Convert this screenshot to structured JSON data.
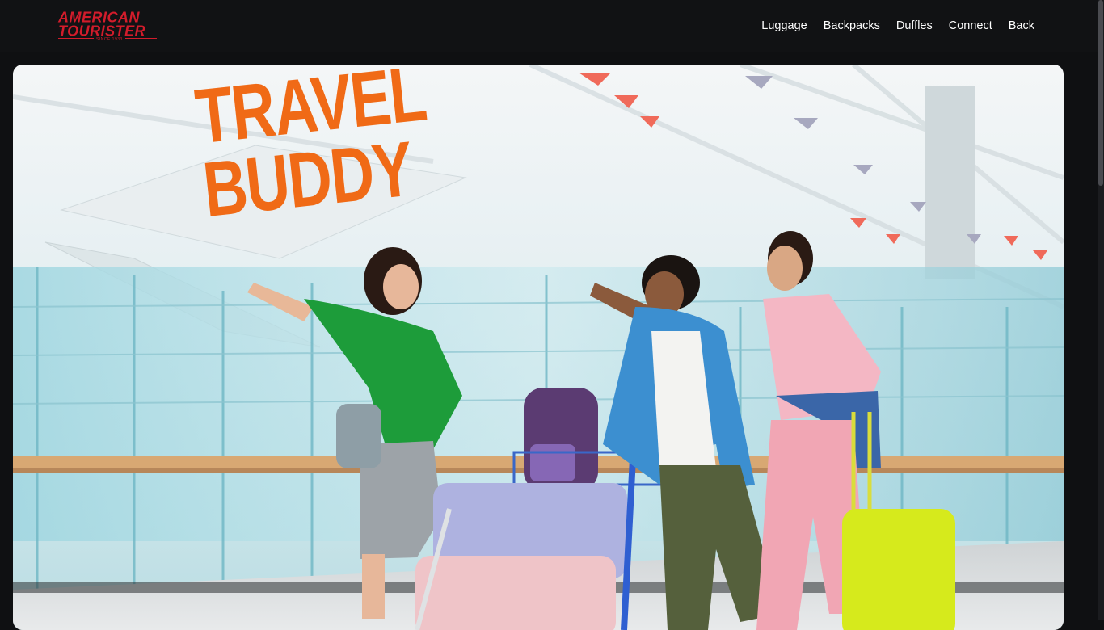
{
  "brand": {
    "name_line1": "AMERICAN",
    "name_line2": "TOURISTER",
    "tagline": "SINCE 1933",
    "color": "#d21c2b"
  },
  "nav": {
    "items": [
      "Luggage",
      "Backpacks",
      "Duffles",
      "Connect",
      "Back"
    ]
  },
  "hero": {
    "title_line1": "TRAVEL",
    "title_line2": "BUDDY",
    "title_color": "#f06a16"
  },
  "colors": {
    "topbar": "#111214",
    "page_bg": "#0f1012"
  }
}
